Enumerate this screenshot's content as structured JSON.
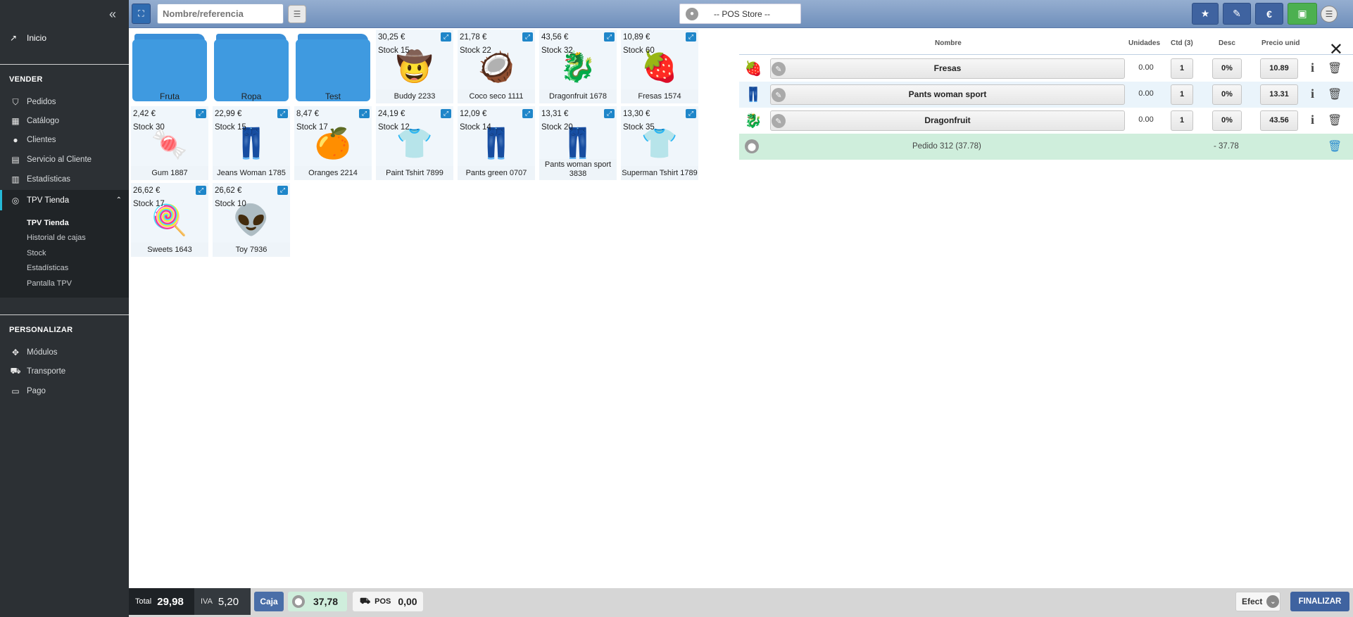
{
  "sidebar": {
    "home_label": "Inicio",
    "section_sell": "VENDER",
    "items_sell": [
      {
        "label": "Pedidos",
        "icon": "basket-icon"
      },
      {
        "label": "Catálogo",
        "icon": "store-icon"
      },
      {
        "label": "Clientes",
        "icon": "user-circle-icon"
      },
      {
        "label": "Servicio al Cliente",
        "icon": "chat-icon"
      },
      {
        "label": "Estadísticas",
        "icon": "bar-chart-icon"
      }
    ],
    "active_item": "TPV Tienda",
    "submenu": [
      "TPV Tienda",
      "Historial de cajas",
      "Stock",
      "Estadísticas",
      "Pantalla TPV"
    ],
    "section_custom": "PERSONALIZAR",
    "items_custom": [
      {
        "label": "Módulos",
        "icon": "puzzle-icon"
      },
      {
        "label": "Transporte",
        "icon": "truck-icon"
      },
      {
        "label": "Pago",
        "icon": "credit-card-icon"
      }
    ]
  },
  "topbar": {
    "search_placeholder": "Nombre/referencia",
    "store_select": "-- POS Store --"
  },
  "categories": [
    {
      "label": "Fruta"
    },
    {
      "label": "Ropa"
    },
    {
      "label": "Test"
    }
  ],
  "products": [
    {
      "name": "Buddy 2233",
      "price": "30,25 €",
      "stock": "Stock 15",
      "icon": "🤠"
    },
    {
      "name": "Coco seco 1111",
      "price": "21,78 €",
      "stock": "Stock 22",
      "icon": "🥥"
    },
    {
      "name": "Dragonfruit 1678",
      "price": "43,56 €",
      "stock": "Stock 32",
      "icon": "🐉"
    },
    {
      "name": "Fresas 1574",
      "price": "10,89 €",
      "stock": "Stock 60",
      "icon": "🍓"
    },
    {
      "name": "Gum 1887",
      "price": "2,42 €",
      "stock": "Stock 30",
      "icon": "🍬"
    },
    {
      "name": "Jeans Woman 1785",
      "price": "22,99 €",
      "stock": "Stock 15",
      "icon": "👖"
    },
    {
      "name": "Oranges 2214",
      "price": "8,47 €",
      "stock": "Stock 17",
      "icon": "🍊"
    },
    {
      "name": "Paint Tshirt 7899",
      "price": "24,19 €",
      "stock": "Stock 12",
      "icon": "👕"
    },
    {
      "name": "Pants green 0707",
      "price": "12,09 €",
      "stock": "Stock 14",
      "icon": "👖"
    },
    {
      "name": "Pants woman sport 3838",
      "price": "13,31 €",
      "stock": "Stock 20",
      "icon": "👖"
    },
    {
      "name": "Superman Tshirt 1789",
      "price": "13,30 €",
      "stock": "Stock 35",
      "icon": "👕"
    },
    {
      "name": "Sweets 1643",
      "price": "26,62 €",
      "stock": "Stock 17",
      "icon": "🍭"
    },
    {
      "name": "Toy 7936",
      "price": "26,62 €",
      "stock": "Stock 10",
      "icon": "👽"
    }
  ],
  "cart": {
    "headers": {
      "name": "Nombre",
      "units": "Unidades",
      "qty": "Ctd (3)",
      "disc": "Desc",
      "price": "Precio unid"
    },
    "rows": [
      {
        "name": "Fresas",
        "units": "0.00",
        "qty": "1",
        "disc": "0%",
        "price": "10.89",
        "icon": "🍓"
      },
      {
        "name": "Pants woman sport",
        "units": "0.00",
        "qty": "1",
        "disc": "0%",
        "price": "13.31",
        "icon": "👖"
      },
      {
        "name": "Dragonfruit",
        "units": "0.00",
        "qty": "1",
        "disc": "0%",
        "price": "43.56",
        "icon": "🐉"
      }
    ],
    "order_label": "Pedido 312 (37.78)",
    "order_amount": "- 37.78"
  },
  "bottombar": {
    "total_label": "Total",
    "total_value": "29,98",
    "iva_label": "IVA",
    "iva_value": "5,20",
    "caja_label": "Caja",
    "paid_value": "37,78",
    "pos_label": "POS",
    "pos_value": "0,00",
    "payment_method": "Efect",
    "finalize_label": "FINALIZAR"
  },
  "colors": {
    "accent": "#3f63a0",
    "sidebar_bg": "#2c3034",
    "save_green": "#4cb050",
    "active_indicator": "#25b9d7"
  }
}
